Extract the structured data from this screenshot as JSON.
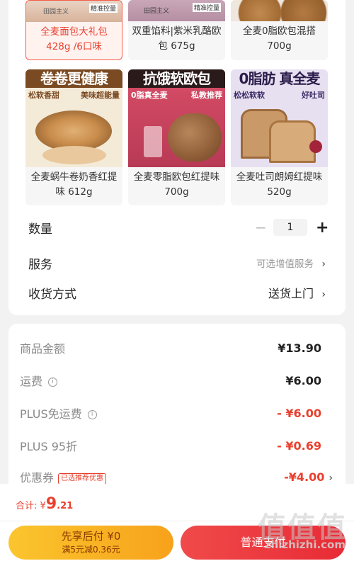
{
  "products_row1": [
    {
      "name": "全麦面包大礼包 428g /6口味",
      "selected": true,
      "tag_left": "田园主义",
      "tag_right": "精准控量"
    },
    {
      "name": "双重馅料|紫米乳酪欧包 675g",
      "selected": false,
      "tag_left": "田园主义",
      "tag_right": "精准控量"
    },
    {
      "name": "全麦0脂欧包混搭 700g",
      "selected": false
    }
  ],
  "products_row2": [
    {
      "name": "全麦蜗牛卷奶香红提味 612g",
      "banner": "卷卷更健康",
      "sub_left": "松软香甜",
      "sub_right": "美味超能量"
    },
    {
      "name": "全麦零脂欧包红提味 700g",
      "banner": "抗饿软欧包",
      "sub_left": "0脂真全麦",
      "sub_right": "私教推荐"
    },
    {
      "name": "全麦吐司朗姆红提味 520g",
      "banner": "0脂肪 真全麦",
      "sub_left": "松松软软",
      "sub_right": "好吐司"
    }
  ],
  "quantity": {
    "label": "数量",
    "value": "1",
    "minus": "−",
    "plus": "+"
  },
  "service": {
    "label": "服务",
    "value": "可选增值服务",
    "chevron": "›"
  },
  "delivery": {
    "label": "收货方式",
    "value": "送货上门",
    "chevron": "›"
  },
  "fees": {
    "goods_label": "商品金额",
    "goods_value": "¥13.90",
    "shipping_label": "运费",
    "shipping_value": "¥6.00",
    "plus_free_label": "PLUS免运费",
    "plus_free_value": "- ¥6.00",
    "plus95_label": "PLUS 95折",
    "plus95_value": "- ¥0.69",
    "coupon_label": "优惠券",
    "coupon_tag": "已选推荐优惠",
    "coupon_value": "-¥4.00",
    "coupon_chevron": "›"
  },
  "footer": {
    "total_label": "合计:",
    "total_currency": "¥",
    "total_int": "9",
    "total_dec": ".21",
    "credit_line1": "先享后付 ¥0",
    "credit_line2": "满5元减0.36元",
    "pay_label": "普通支付"
  },
  "watermark": {
    "glyphs": "值值值",
    "site": "zhizhizhi.com"
  },
  "colors": {
    "accent": "#e8402e",
    "credit": "#fbc52e",
    "pay": "#e82b36"
  }
}
